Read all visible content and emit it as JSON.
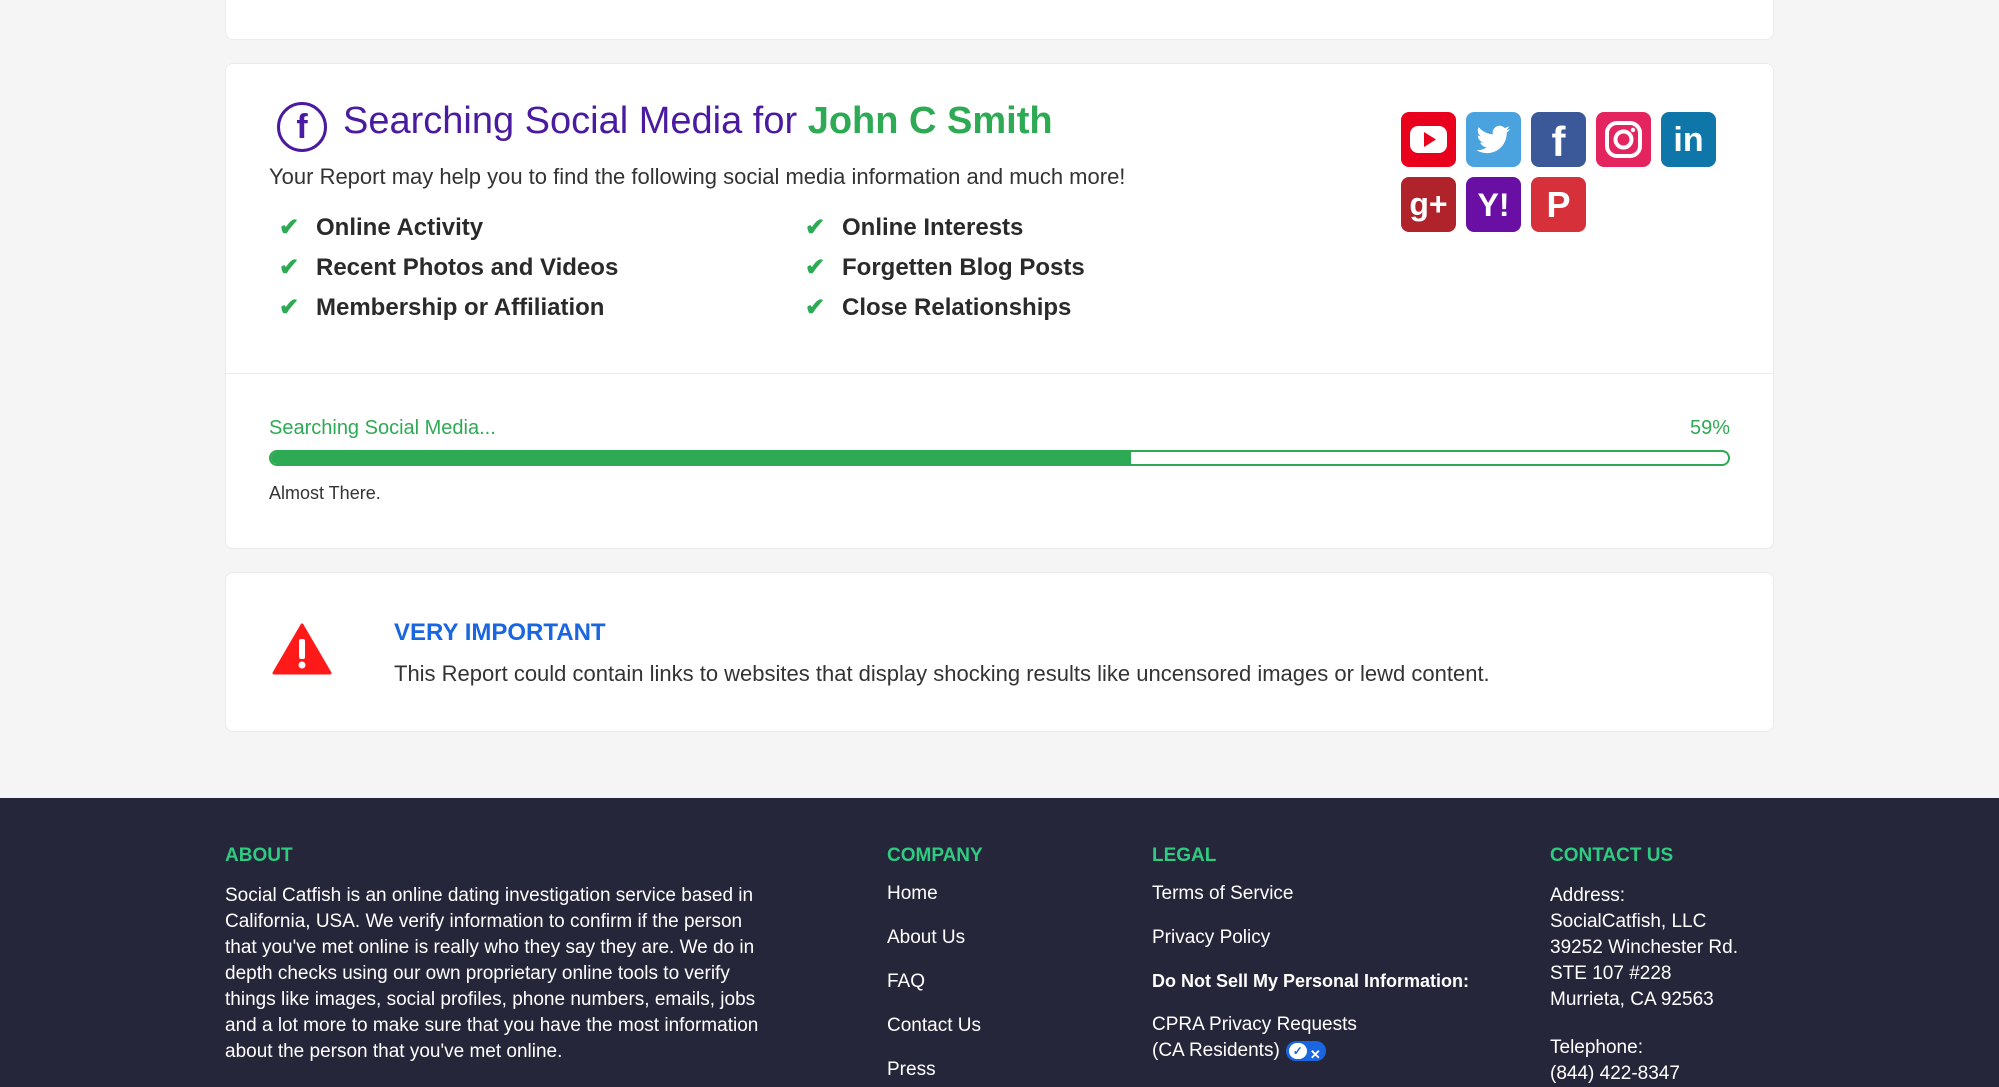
{
  "social": {
    "title_prefix": "Searching Social Media for ",
    "name": "John C Smith",
    "subtitle": "Your Report may help you to find the following social media information and much more!",
    "features": [
      "Online Activity",
      "Recent Photos and Videos",
      "Membership or Affiliation",
      "Online Interests",
      "Forgetten Blog Posts",
      "Close Relationships"
    ],
    "icons": [
      "youtube-icon",
      "twitter-icon",
      "facebook-icon",
      "instagram-icon",
      "linkedin-icon",
      "google-plus-icon",
      "yahoo-icon",
      "pinterest-icon"
    ],
    "icon_glyphs": {
      "facebook": "f",
      "linkedin": "in",
      "google_plus": "g+",
      "yahoo": "Y!",
      "pinterest": "P"
    }
  },
  "progress": {
    "label": "Searching Social Media...",
    "percent_text": "59%",
    "fraction": 0.59,
    "note": "Almost There."
  },
  "warning": {
    "title": "VERY IMPORTANT",
    "text": "This Report could contain links to websites that display shocking results like uncensored images or lewd content."
  },
  "footer": {
    "about": {
      "heading": "ABOUT",
      "text": "Social Catfish is an online dating investigation service based in California, USA. We verify information to confirm if the person that you've met online is really who they say they are. We do in depth checks using our own proprietary online tools to verify things like images, social profiles, phone numbers, emails, jobs and a lot more to make sure that you have the most information about the person that you've met online."
    },
    "company": {
      "heading": "COMPANY",
      "links": [
        "Home",
        "About Us",
        "FAQ",
        "Contact Us",
        "Press"
      ]
    },
    "legal": {
      "heading": "LEGAL",
      "links": [
        "Terms of Service",
        "Privacy Policy"
      ],
      "do_not_sell": "Do Not Sell My Personal Information:",
      "cpra_line1": "CPRA Privacy Requests",
      "cpra_line2": "(CA Residents)"
    },
    "contact": {
      "heading": "CONTACT US",
      "address_label": "Address:",
      "address_lines": [
        "SocialCatfish, LLC",
        "39252 Winchester Rd.",
        "STE 107 #228",
        "Murrieta, CA 92563"
      ],
      "telephone_label": "Telephone:",
      "telephone": "(844) 422-8347"
    }
  },
  "colors": {
    "brand_purple": "#4a1aa0",
    "accent_green": "#2eaa55",
    "warning_blue": "#1a66e0",
    "footer_bg": "#26263b",
    "footer_heading": "#2ecc80"
  }
}
